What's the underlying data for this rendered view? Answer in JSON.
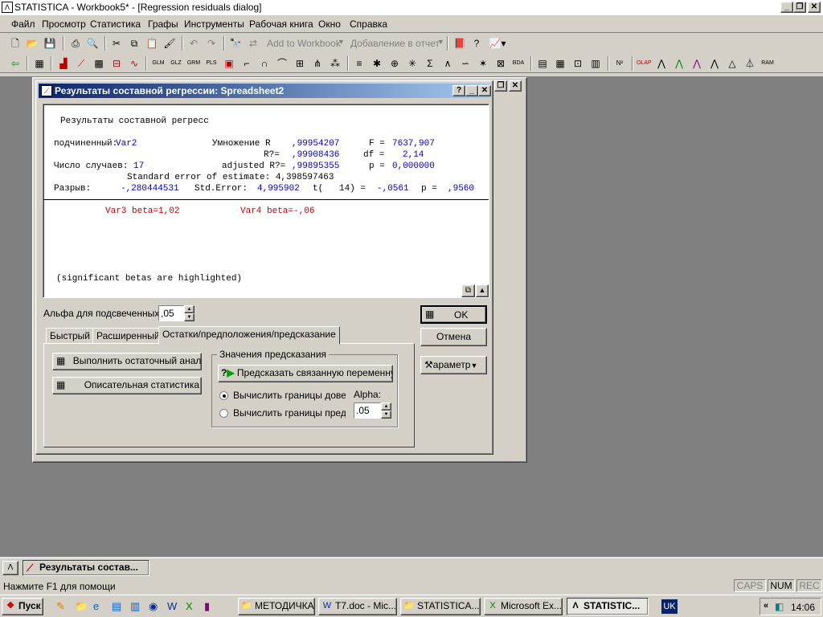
{
  "app": {
    "title": "STATISTICA - Workbook5* - [Regression residuals dialog]"
  },
  "menu": [
    "Файл",
    "Просмотр",
    "Статистика",
    "Графы",
    "Инструменты",
    "Рабочая книга",
    "Окно",
    "Справка"
  ],
  "toolbar": {
    "add_to_workbook": "Add to Workbook",
    "add_to_report": "Добавление в отчет"
  },
  "dialog": {
    "title": "Результаты составной регрессии: Spreadsheet2",
    "report": {
      "heading": "Результаты составной регресс",
      "dep_label": "подчиненный:",
      "dep_value": "Var2",
      "mult_r_label": "Умножение R",
      "mult_r": ",99954207",
      "f_label": "F =",
      "f_value": "7637,907",
      "r2_label": "R?=",
      "r2": ",99908436",
      "df_label": "df =",
      "df_value": "2,14",
      "cases_label": "Число случаев:",
      "cases_value": "17",
      "adj_r2_label": "adjusted R?=",
      "adj_r2": ",99895355",
      "p_label": "p =",
      "p_value": "0,000000",
      "se_line": "Standard error of estimate: 4,398597463",
      "intercept_label": "Разрыв:",
      "intercept_value": "-,280444531",
      "std_err_label": "Std.Error:",
      "std_err_value": "4,995902",
      "t_label": "t(   14) =",
      "t_value": "-,0561",
      "p2_label": "p =",
      "p2_value": ",9560",
      "beta1": "Var3 beta=1,02",
      "beta2": "Var4 beta=-,06",
      "note": "(significant betas are highlighted)"
    },
    "alpha_label": "Альфа для подсвеченных",
    "alpha_value": ",05",
    "ok_label": "OK",
    "cancel_label": "Отмена",
    "options_label": "араметр",
    "tabs": [
      "Быстрый",
      "Расширенный",
      "Остатки/предположения/предсказание"
    ],
    "run_residual_label": "Выполнить остаточный анали",
    "desc_stats_label": "Описательная статистика",
    "prediction_group": "Значения предсказания",
    "predict_label": "Предсказать связанную переменну",
    "radio1_label": "Вычислить границы довери",
    "radio2_label": "Вычислить границы предск",
    "alpha2_label": "Alpha:",
    "alpha2_value": ".05"
  },
  "task_window": "Результаты состав...",
  "status": {
    "help": "Нажмите F1 для помощи",
    "caps": "CAPS",
    "num": "NUM",
    "rec": "REC"
  },
  "taskbar": {
    "start": "Пуск",
    "items": [
      "МЕТОДИЧКА",
      "T7.doc - Mic...",
      "STATISTICA...",
      "Microsoft Ex...",
      "STATISTIC..."
    ],
    "lang": "UK",
    "time": "14:06"
  }
}
